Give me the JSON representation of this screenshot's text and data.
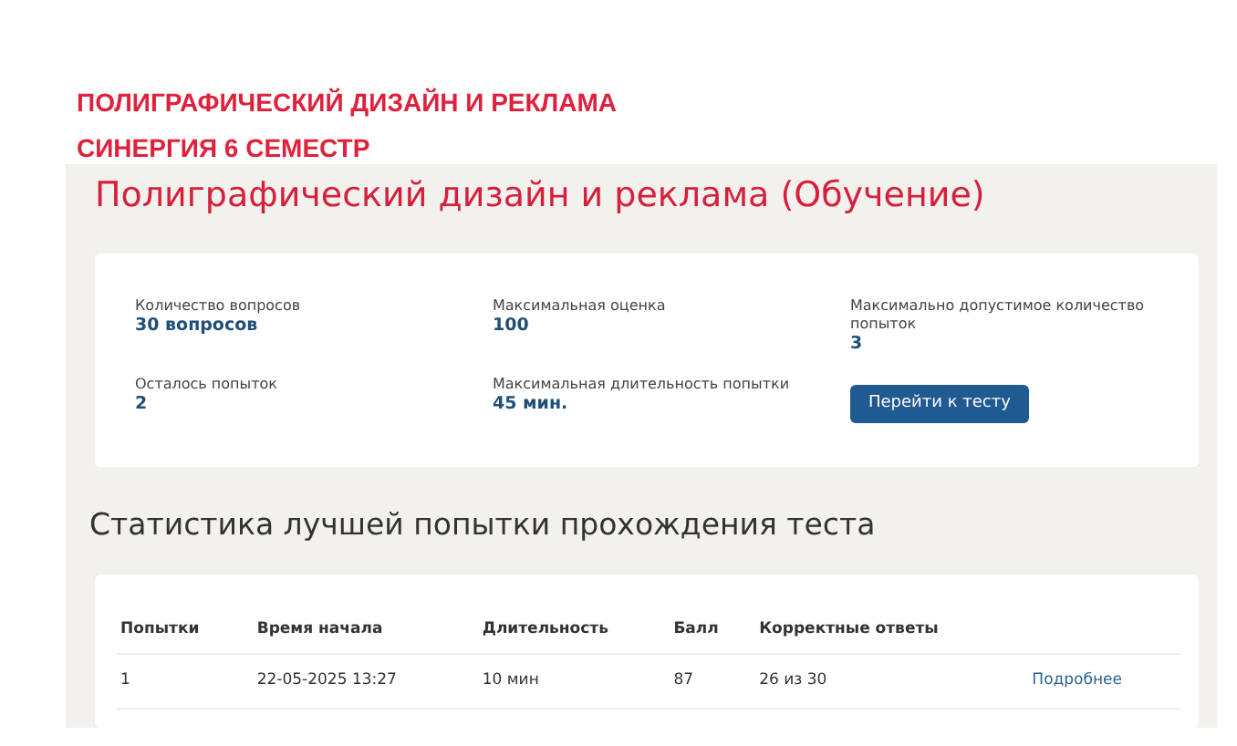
{
  "headings": [
    "ПОЛИГРАФИЧЕСКИЙ ДИЗАЙН И РЕКЛАМА",
    "СИНЕРГИЯ 6 СЕМЕСТР"
  ],
  "title": "Полиграфический дизайн и реклама (Обучение)",
  "info": [
    {
      "label": "Количество вопросов",
      "value": "30 вопросов"
    },
    {
      "label": "Максимальная оценка",
      "value": "100"
    },
    {
      "label": "Максимально допустимое количество попыток",
      "value": "3"
    },
    {
      "label": "Осталось попыток",
      "value": "2"
    },
    {
      "label": "Максимальная длительность попытки",
      "value": "45 мин."
    }
  ],
  "start_button": "Перейти к тесту",
  "stats_title": "Статистика лучшей попытки прохождения теста",
  "table": {
    "columns": [
      "Попытки",
      "Время начала",
      "Длительность",
      "Балл",
      "Корректные ответы",
      ""
    ],
    "rows": [
      {
        "cells": [
          "1",
          "22-05-2025 13:27",
          "10 мин",
          "87",
          "26 из 30"
        ],
        "link": "Подробнее"
      }
    ]
  }
}
